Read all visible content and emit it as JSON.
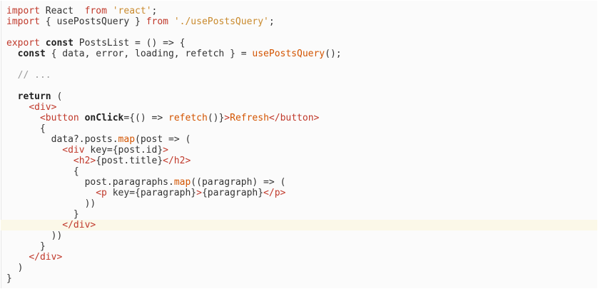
{
  "code": {
    "lines": [
      [
        {
          "t": "import",
          "c": "kw"
        },
        {
          "t": " React  ",
          "c": "pl"
        },
        {
          "t": "from",
          "c": "kw"
        },
        {
          "t": " ",
          "c": "pl"
        },
        {
          "t": "'react'",
          "c": "str"
        },
        {
          "t": ";",
          "c": "pl"
        }
      ],
      [
        {
          "t": "import",
          "c": "kw"
        },
        {
          "t": " { usePostsQuery } ",
          "c": "pl"
        },
        {
          "t": "from",
          "c": "kw"
        },
        {
          "t": " ",
          "c": "pl"
        },
        {
          "t": "'./usePostsQuery'",
          "c": "str"
        },
        {
          "t": ";",
          "c": "pl"
        }
      ],
      [],
      [
        {
          "t": "export",
          "c": "kw"
        },
        {
          "t": " ",
          "c": "pl"
        },
        {
          "t": "const",
          "c": "kwb"
        },
        {
          "t": " PostsList = () => {",
          "c": "pl"
        }
      ],
      [
        {
          "t": "  ",
          "c": "pl"
        },
        {
          "t": "const",
          "c": "kwb"
        },
        {
          "t": " { data, error, loading, refetch } = ",
          "c": "pl"
        },
        {
          "t": "usePostsQuery",
          "c": "fn"
        },
        {
          "t": "();",
          "c": "pl"
        }
      ],
      [],
      [
        {
          "t": "  // ...",
          "c": "cm"
        }
      ],
      [],
      [
        {
          "t": "  ",
          "c": "pl"
        },
        {
          "t": "return",
          "c": "kwb"
        },
        {
          "t": " (",
          "c": "pl"
        }
      ],
      [
        {
          "t": "    ",
          "c": "pl"
        },
        {
          "t": "<div>",
          "c": "tag"
        }
      ],
      [
        {
          "t": "      ",
          "c": "pl"
        },
        {
          "t": "<button",
          "c": "tag"
        },
        {
          "t": " ",
          "c": "pl"
        },
        {
          "t": "onClick",
          "c": "attr"
        },
        {
          "t": "={() => ",
          "c": "pl"
        },
        {
          "t": "refetch",
          "c": "fn"
        },
        {
          "t": "()}",
          "c": "pl"
        },
        {
          "t": ">",
          "c": "tag"
        },
        {
          "t": "Refresh",
          "c": "fn"
        },
        {
          "t": "</button>",
          "c": "tag"
        }
      ],
      [
        {
          "t": "      {",
          "c": "pl"
        }
      ],
      [
        {
          "t": "        data?.posts.",
          "c": "pl"
        },
        {
          "t": "map",
          "c": "fn"
        },
        {
          "t": "(post => (",
          "c": "pl"
        }
      ],
      [
        {
          "t": "          ",
          "c": "pl"
        },
        {
          "t": "<div",
          "c": "tag"
        },
        {
          "t": " key={post.id}",
          "c": "pl"
        },
        {
          "t": ">",
          "c": "tag"
        }
      ],
      [
        {
          "t": "            ",
          "c": "pl"
        },
        {
          "t": "<h2>",
          "c": "tag"
        },
        {
          "t": "{post.title}",
          "c": "pl"
        },
        {
          "t": "</h2>",
          "c": "tag"
        }
      ],
      [
        {
          "t": "            {",
          "c": "pl"
        }
      ],
      [
        {
          "t": "              post.paragraphs.",
          "c": "pl"
        },
        {
          "t": "map",
          "c": "fn"
        },
        {
          "t": "((paragraph) => (",
          "c": "pl"
        }
      ],
      [
        {
          "t": "                ",
          "c": "pl"
        },
        {
          "t": "<p",
          "c": "tag"
        },
        {
          "t": " key={paragraph}",
          "c": "pl"
        },
        {
          "t": ">",
          "c": "tag"
        },
        {
          "t": "{paragraph}",
          "c": "pl"
        },
        {
          "t": "</p>",
          "c": "tag"
        }
      ],
      [
        {
          "t": "              ))",
          "c": "pl"
        }
      ],
      [
        {
          "t": "            }",
          "c": "pl"
        }
      ],
      [
        {
          "t": "          ",
          "c": "pl"
        },
        {
          "t": "</div>",
          "c": "tag"
        }
      ],
      [
        {
          "t": "        ))",
          "c": "pl"
        }
      ],
      [
        {
          "t": "      }",
          "c": "pl"
        }
      ],
      [
        {
          "t": "    ",
          "c": "pl"
        },
        {
          "t": "</div>",
          "c": "tag"
        }
      ],
      [
        {
          "t": "  )",
          "c": "pl"
        }
      ],
      [
        {
          "t": "}",
          "c": "pl"
        }
      ]
    ],
    "active_line": 20
  }
}
